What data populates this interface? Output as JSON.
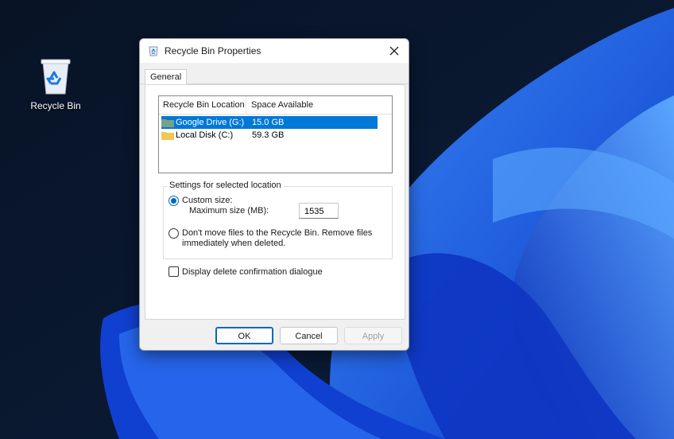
{
  "desktop": {
    "icon_label": "Recycle Bin",
    "accent": "#0067c0"
  },
  "dialog": {
    "title": "Recycle Bin Properties",
    "tab": "General",
    "list": {
      "headers": [
        "Recycle Bin Location",
        "Space Available"
      ],
      "rows": [
        {
          "name": "Google Drive (G:)",
          "space": "15.0 GB",
          "selected": true
        },
        {
          "name": "Local Disk  (C:)",
          "space": "59.3 GB",
          "selected": false
        }
      ]
    },
    "settings": {
      "legend": "Settings for selected location",
      "custom_label": "Custom size:",
      "max_label": "Maximum size (MB):",
      "max_value": "1535",
      "nomove_line1": "Don't move files to the Recycle Bin. Remove files",
      "nomove_line2": "immediately when deleted."
    },
    "confirm_label": "Display delete confirmation dialogue",
    "buttons": {
      "ok": "OK",
      "cancel": "Cancel",
      "apply": "Apply"
    }
  }
}
